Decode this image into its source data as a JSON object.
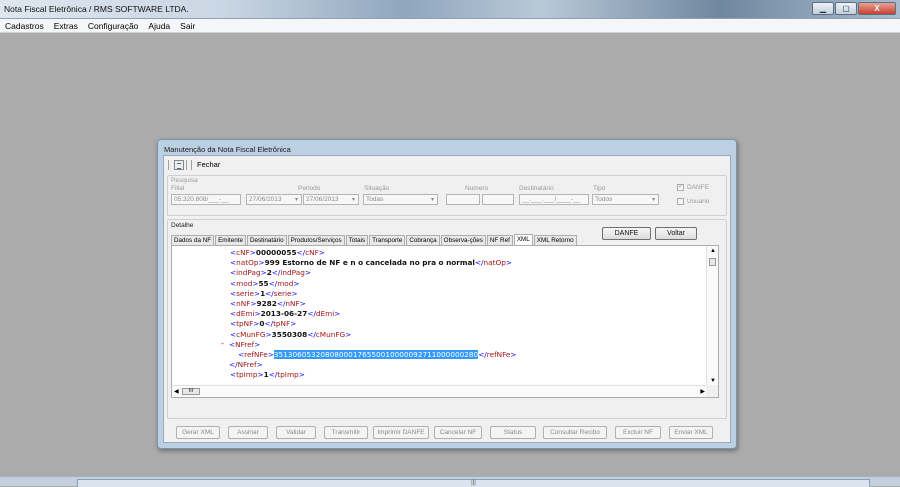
{
  "window": {
    "title": "Nota Fiscal Eletrônica / RMS SOFTWARE LTDA.",
    "controls": [
      "▁",
      "▢",
      "X"
    ]
  },
  "menu": [
    "Cadastros",
    "Extras",
    "Configuração",
    "Ajuda",
    "Sair"
  ],
  "bottom_handle": "|||",
  "dialog": {
    "title": "Manutenção da Nota Fiscal Eletrônica",
    "toolbar": {
      "close_label": "Fechar"
    },
    "search": {
      "group_label": "Pesquisa",
      "filial_label": "Filial",
      "filial_value": "05.320.808/___-__",
      "periodo_label": "Periodo",
      "date_from": "27/06/2013",
      "date_to": "27/06/2013",
      "situacao_label": "Situação",
      "situacao_value": "Todas",
      "numero_label": "Numero",
      "destinatario_label": "Destinatário",
      "destinatario_value": "__.___.___/____-__",
      "tipo_label": "Tipo",
      "tipo_value": "Todos",
      "danfe_check_label": "DANFE",
      "usuario_check_label": "Usuario"
    },
    "detail": {
      "group_label": "Detalhe",
      "danfe_button": "DANFE",
      "voltar_button": "Voltar",
      "tabs": [
        "Dados da NF",
        "Emitente",
        "Destinatário",
        "Produtos/Serviços",
        "Totais",
        "Transporte",
        "Cobrança",
        "Observa-ções",
        "NF Ref",
        "XML",
        "XML Retorno"
      ],
      "active_tab": "XML",
      "xml_lines": [
        {
          "tag": "cNF",
          "value": "00000055"
        },
        {
          "tag": "natOp",
          "value": "999 Estorno de NF e n o cancelada no pra o normal"
        },
        {
          "tag": "indPag",
          "value": "2"
        },
        {
          "tag": "mod",
          "value": "55"
        },
        {
          "tag": "serie",
          "value": "1"
        },
        {
          "tag": "nNF",
          "value": "9282"
        },
        {
          "tag": "dEmi",
          "value": "2013-06-27"
        },
        {
          "tag": "tpNF",
          "value": "0"
        },
        {
          "tag": "cMunFG",
          "value": "3550308"
        },
        {
          "open": "NFref",
          "collapse": "-"
        },
        {
          "tag": "refNFe",
          "value": "35130605320808000176550010000092711000000280",
          "selected": true
        },
        {
          "close": "NFref"
        },
        {
          "tag": "tpImp",
          "value": "1"
        }
      ],
      "hscroll_thumb": "III"
    },
    "actions": [
      "Gerar XML",
      "Assinar",
      "Validar",
      "Transmitir",
      "Imprimir DANFE",
      "Cancelar NF",
      "Status",
      "Consultar Recibo",
      "Excluir NF",
      "Enviar XML"
    ]
  }
}
